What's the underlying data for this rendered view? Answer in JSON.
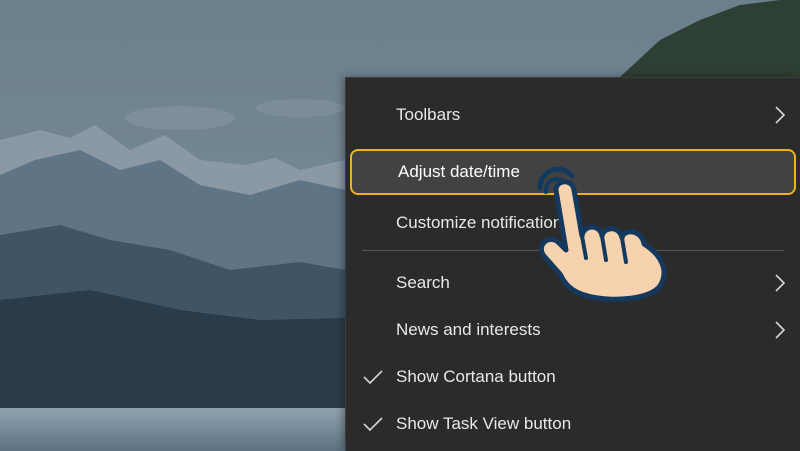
{
  "menu": {
    "items": [
      {
        "label": "Toolbars",
        "has_submenu": true,
        "checked": false,
        "highlighted": false
      },
      {
        "label": "Adjust date/time",
        "has_submenu": false,
        "checked": false,
        "highlighted": true
      },
      {
        "label": "Customize notification",
        "has_submenu": false,
        "checked": false,
        "highlighted": false
      },
      {
        "label": "Search",
        "has_submenu": true,
        "checked": false,
        "highlighted": false
      },
      {
        "label": "News and interests",
        "has_submenu": true,
        "checked": false,
        "highlighted": false
      },
      {
        "label": "Show Cortana button",
        "has_submenu": false,
        "checked": true,
        "highlighted": false
      },
      {
        "label": "Show Task View button",
        "has_submenu": false,
        "checked": true,
        "highlighted": false
      }
    ]
  },
  "colors": {
    "menu_bg": "#2b2b2b",
    "highlight_border": "#f0b21c",
    "hand_fill": "#f7d2ae",
    "hand_outline": "#133a5e"
  },
  "icons": {
    "submenu": "chevron-right-icon",
    "checked": "checkmark-icon",
    "pointer": "tapping-hand-icon"
  }
}
